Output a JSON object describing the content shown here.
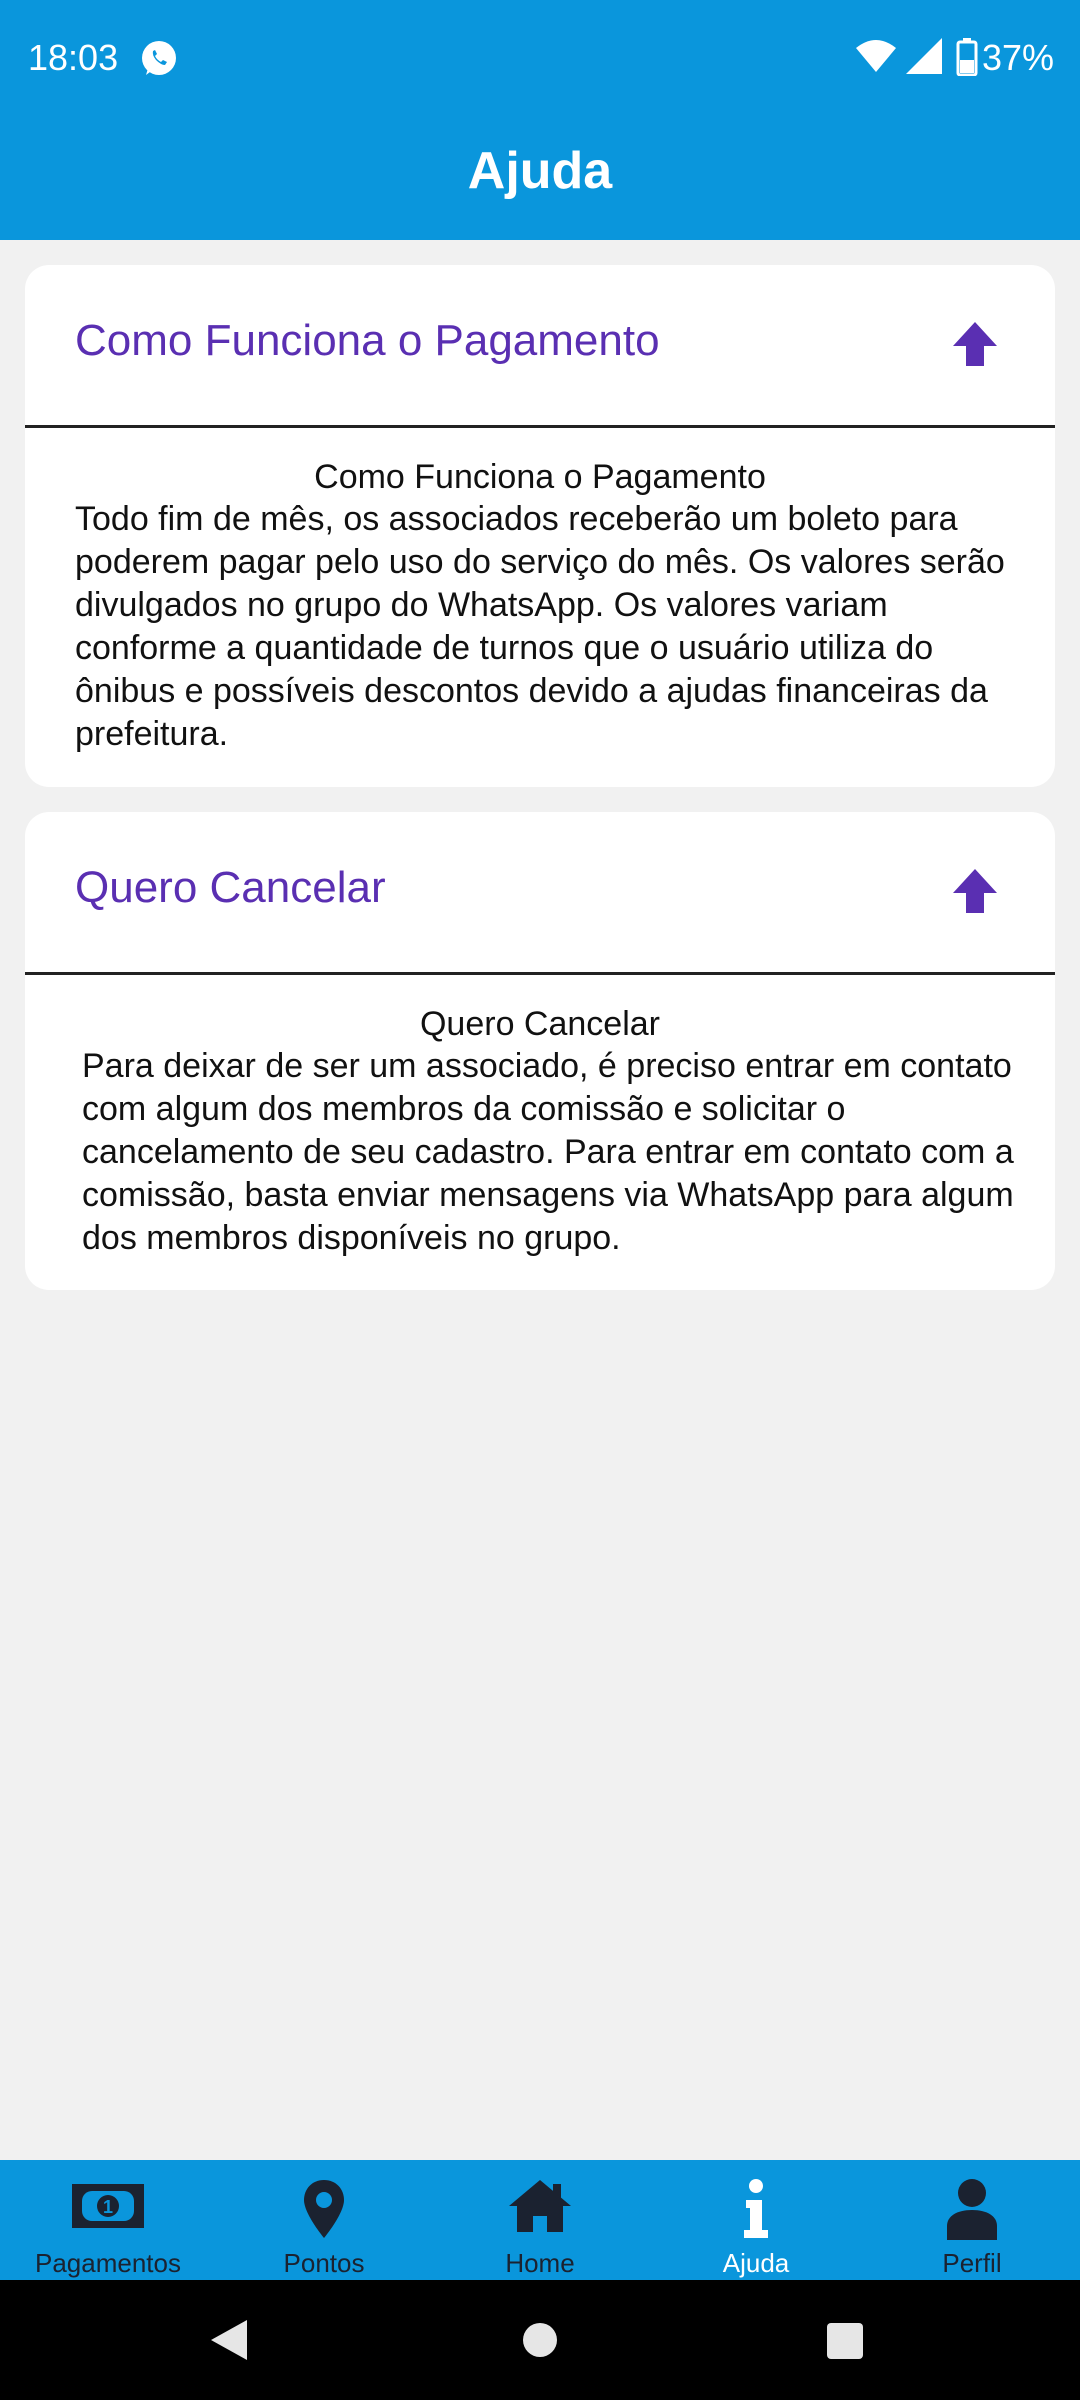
{
  "status_bar": {
    "time": "18:03",
    "battery": "37%",
    "icons": [
      "whatsapp-icon",
      "wifi-icon",
      "signal-icon",
      "battery-icon"
    ]
  },
  "header": {
    "title": "Ajuda"
  },
  "faq": [
    {
      "title": "Como Funciona o Pagamento",
      "body_title": "Como Funciona o Pagamento",
      "body": "Todo fim de mês, os associados receberão um boleto para poderem pagar pelo uso do serviço do mês. Os valores serão divulgados no grupo do WhatsApp. Os valores variam conforme a quantidade de turnos que o usuário utiliza do ônibus e possíveis descontos devido a ajudas financeiras da prefeitura.",
      "toggle_icon": "arrow-up-icon"
    },
    {
      "title": "Quero Cancelar",
      "body_title": "Quero Cancelar",
      "body": "Para deixar de ser um associado, é preciso entrar em contato com algum dos membros da comissão e solicitar o cancelamento de seu cadastro. Para entrar em contato com a comissão, basta enviar mensagens via WhatsApp para algum dos membros disponíveis no grupo.",
      "toggle_icon": "arrow-up-icon"
    }
  ],
  "bottom_nav": [
    {
      "label": "Pagamentos",
      "icon": "money-icon"
    },
    {
      "label": "Pontos",
      "icon": "map-pin-icon"
    },
    {
      "label": "Home",
      "icon": "home-icon"
    },
    {
      "label": "Ajuda",
      "icon": "info-icon",
      "active": true
    },
    {
      "label": "Perfil",
      "icon": "user-icon"
    }
  ],
  "colors": {
    "primary": "#0a96dc",
    "accent": "#5a2fb2",
    "background": "#f1f1f1",
    "nav_label": "#1b2230"
  }
}
